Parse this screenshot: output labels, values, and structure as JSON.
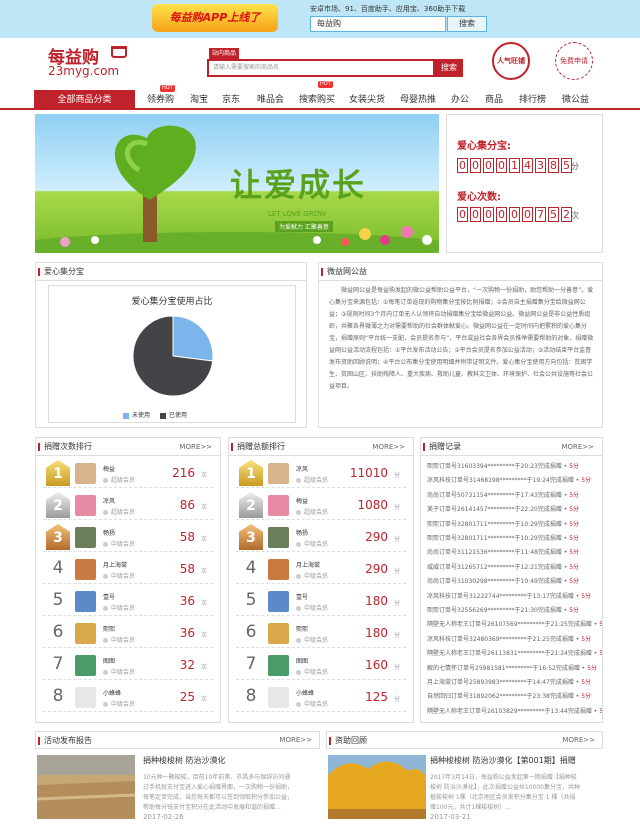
{
  "topbar": {
    "app_banner": "每益购APP上线了",
    "app_stores": "安卓市场、91、百度助手、应用宝、360助手下载",
    "app_search_value": "每益购",
    "app_search_button": "搜索"
  },
  "header": {
    "logo_cn": "每益购",
    "logo_en": "23myg.com",
    "search_tab": "站内商品",
    "search_placeholder": "请输入需要搜索的商品名",
    "search_button": "搜索",
    "badge_popularity": "人气旺铺",
    "badge_service": "免费申请"
  },
  "nav": {
    "all_categories": "全部商品分类",
    "items": [
      "领券购",
      "淘宝",
      "京东",
      "唯品会",
      "搜索购买",
      "女装尖货",
      "母婴热推",
      "办公",
      "商品",
      "排行榜",
      "微公益"
    ],
    "hot_label": "HOT"
  },
  "hero": {
    "title": "让爱成长",
    "subtitle": "LET LOVE GROW",
    "tag": "为爱献力 汇聚善意"
  },
  "stats": {
    "points_label": "爱心集分宝:",
    "points_digits": [
      "0",
      "0",
      "0",
      "0",
      "1",
      "4",
      "3",
      "8",
      "5"
    ],
    "points_unit": "分",
    "count_label": "爱心次数:",
    "count_digits": [
      "0",
      "0",
      "0",
      "0",
      "0",
      "0",
      "7",
      "5",
      "2"
    ],
    "count_unit": "次"
  },
  "love_points_panel": {
    "title": "爱心集分宝",
    "chart_title": "爱心集分宝使用占比",
    "legend_unused": "未使用",
    "legend_used": "已使用"
  },
  "chart_data": {
    "type": "pie",
    "title": "爱心集分宝使用占比",
    "labels": [
      "未使用",
      "已使用"
    ],
    "values": [
      27,
      73
    ],
    "colors": [
      "#7cb5ec",
      "#434348"
    ],
    "legend": "bottom"
  },
  "charity_panel": {
    "title": "微益网公益",
    "text": "微益网公益是每益购发起的微公益帮助公益平台，“一次购物一份捐助，助您帮助一分善意”。爱心集分宝来源包括：①每笔订单返现的购物集分宝按比例捐赠；②会员自主捐赠集分宝给微益网公益；③规则时间3个月内订单无人认领将自动捐赠集分宝给微益网公益。微益网公益是非公益性质组织，共聚各界微薄之力对需要帮助的社会群体献爱心。微益网公益在一定时间内把累积的爱心集分宝，捐赠原则“平台统一支配，会员提名参与”，平台或益社会各界会员推举需要帮助的对象，捐赠微益网公益活动流程包括：①平台发布活动公告；②平台会员提名参加公益活动；③活动结束平台监督发布资助回顾说明；④平台公布集分宝使用明细并附带证明文件。爱心集分宝使用方向包括：贫困学生、贫困山区、扶助残障人、重大疾病、救助儿童、教科文卫体、环境保护、社会公共设施等社会公益项目。"
  },
  "rank_count": {
    "title": "捐赠次数排行",
    "more": "MORE>>",
    "unit": "次",
    "rows": [
      {
        "rank": "1",
        "name": "梅益",
        "level": "超级会员",
        "amount": "216"
      },
      {
        "rank": "2",
        "name": "凉风",
        "level": "超级会员",
        "amount": "86"
      },
      {
        "rank": "3",
        "name": "畅扬",
        "level": "中级会员",
        "amount": "58"
      },
      {
        "rank": "4",
        "name": "月上海棠",
        "level": "中级会员",
        "amount": "58"
      },
      {
        "rank": "5",
        "name": "壹号",
        "level": "中级会员",
        "amount": "36"
      },
      {
        "rank": "6",
        "name": "熙熙",
        "level": "中级会员",
        "amount": "36"
      },
      {
        "rank": "7",
        "name": "图图",
        "level": "中级会员",
        "amount": "32"
      },
      {
        "rank": "8",
        "name": "小蜂蜂",
        "level": "中级会员",
        "amount": "25"
      }
    ]
  },
  "rank_points": {
    "title": "捐赠总额排行",
    "more": "MORE>>",
    "unit": "分",
    "rows": [
      {
        "rank": "1",
        "name": "凉风",
        "level": "超级会员",
        "amount": "11010"
      },
      {
        "rank": "2",
        "name": "梅益",
        "level": "超级会员",
        "amount": "1080"
      },
      {
        "rank": "3",
        "name": "畅扬",
        "level": "中级会员",
        "amount": "290"
      },
      {
        "rank": "4",
        "name": "月上海棠",
        "level": "中级会员",
        "amount": "290"
      },
      {
        "rank": "5",
        "name": "壹号",
        "level": "中级会员",
        "amount": "180"
      },
      {
        "rank": "6",
        "name": "熙熙",
        "level": "中级会员",
        "amount": "180"
      },
      {
        "rank": "7",
        "name": "图图",
        "level": "中级会员",
        "amount": "160"
      },
      {
        "rank": "8",
        "name": "小蜂蜂",
        "level": "中级会员",
        "amount": "125"
      }
    ]
  },
  "records": {
    "title": "捐赠记录",
    "more": "MORE>>",
    "items": [
      {
        "text": "熙熙订单号31603394*********于20:23完成捐赠",
        "amount": "5分"
      },
      {
        "text": "凉风科技订单号31468198*********于19:24完成捐赠",
        "amount": "5分"
      },
      {
        "text": "尚尚订单号50731154*********于17:43完成捐赠",
        "amount": "5分"
      },
      {
        "text": "美子订单号26141457*********于22:20完成捐赠",
        "amount": "5分"
      },
      {
        "text": "熙熙订单号32801711*********于10:29完成捐赠",
        "amount": "5分"
      },
      {
        "text": "熙熙订单号32801711*********于10:29完成捐赠",
        "amount": "5分"
      },
      {
        "text": "尚尚订单号31121536*********于11:48完成捐赠",
        "amount": "5分"
      },
      {
        "text": "威威订单号31265712*********于12:21完成捐赠",
        "amount": "5分"
      },
      {
        "text": "尚尚订单号31030298*********于10:49完成捐赠",
        "amount": "5分"
      },
      {
        "text": "凉风科技订单号31222744*********于13:17完成捐赠",
        "amount": "5分"
      },
      {
        "text": "熙熙订单号32556269*********于21:30完成捐赠",
        "amount": "5分"
      },
      {
        "text": "隔壁无人称老王订单号26107569*********于21:25完成捐赠",
        "amount": "5分"
      },
      {
        "text": "凉风科技订单号32480369*********于21:25完成捐赠",
        "amount": "5分"
      },
      {
        "text": "隔壁无人称老王订单号26113831*********于21:24完成捐赠",
        "amount": "5分"
      },
      {
        "text": "解的七情怀订单号25981581*********于16:52完成捐赠",
        "amount": "5分"
      },
      {
        "text": "月上海棠订单号25893983*********于14:47完成捐赠",
        "amount": "5分"
      },
      {
        "text": "自然回归订单号31892062*********于23:38完成捐赠",
        "amount": "5分"
      },
      {
        "text": "隔壁无人称老王订单号26103829*********于13:44完成捐赠",
        "amount": "5分"
      }
    ]
  },
  "activities": {
    "title": "活动发布报告",
    "more": "MORE>>",
    "news_title": "捐种梭梭树 防治沙漠化",
    "news_desc": "10元种一颗梭梭，目前10年前第，亦昌多与保辞访问通过手机就支付宝进入爱心捐赠界面，一次购物一份捐助，每笔定单完成，当您每天都可以签到领取积分参加公益，帮助每分钱支付宝积分在此活动中发展和谐的捐赠...",
    "news_date": "2017-02-26"
  },
  "review": {
    "title": "资助回顾",
    "more": "MORE>>",
    "news_title": "捐种梭梭树 防治沙漠化【第001期】捐赠",
    "news_desc": "2017年3月14日，每益购公益发起第一期捐赠【捐种梭梭树 防治沙漠化】，此次捐赠公益共10000集分宝，共种植梭梭树 1棵（北京地区会员发积分集分宝 1 棵（共捐赠100元，共计1棵梭梭树）...",
    "news_date": "2017-03-21"
  }
}
